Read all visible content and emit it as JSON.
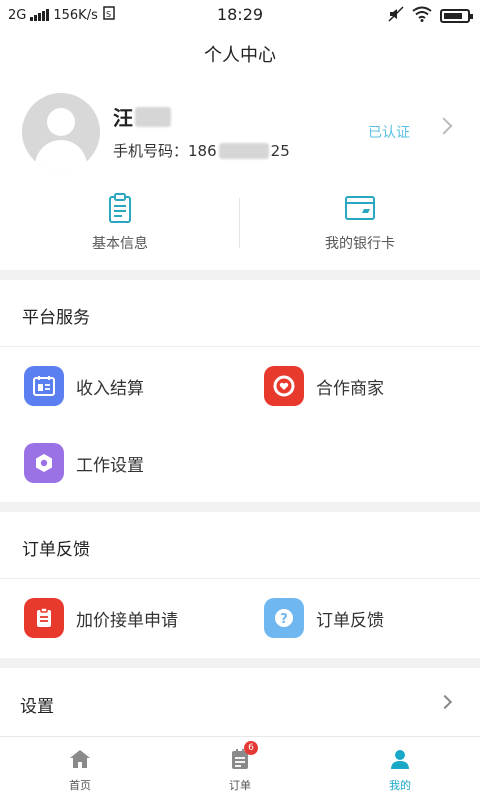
{
  "status_bar": {
    "network": "2G",
    "speed": "156K/s",
    "time": "18:29",
    "battery_level": 0.8
  },
  "header": {
    "title": "个人中心"
  },
  "profile": {
    "name_visible": "汪",
    "phone_label": "手机号码：",
    "phone_prefix": "186",
    "phone_suffix": "25",
    "verified_label": "已认证",
    "icons": {
      "avatar": "avatar-placeholder-icon",
      "chevron": "chevron-right-icon"
    }
  },
  "quick_actions": [
    {
      "label": "基本信息",
      "icon": "clipboard-icon"
    },
    {
      "label": "我的银行卡",
      "icon": "bank-card-icon"
    }
  ],
  "platform_services": {
    "title": "平台服务",
    "items": [
      {
        "label": "收入结算",
        "icon": "settlement-icon",
        "color": "#5b7ff0"
      },
      {
        "label": "合作商家",
        "icon": "partner-icon",
        "color": "#e8392d"
      },
      {
        "label": "工作设置",
        "icon": "work-settings-icon",
        "color": "#9b72e6"
      }
    ]
  },
  "order_feedback": {
    "title": "订单反馈",
    "items": [
      {
        "label": "加价接单申请",
        "icon": "markup-request-icon",
        "color": "#e8392d"
      },
      {
        "label": "订单反馈",
        "icon": "question-icon",
        "color": "#6fb7f0"
      }
    ]
  },
  "settings": {
    "label": "设置"
  },
  "tabbar": {
    "items": [
      {
        "label": "首页",
        "icon": "home-icon",
        "active": false
      },
      {
        "label": "订单",
        "icon": "order-icon",
        "active": false,
        "badge": "6"
      },
      {
        "label": "我的",
        "icon": "profile-icon",
        "active": true
      }
    ]
  },
  "colors": {
    "accent": "#1aa8c8",
    "verified": "#5bc0e0",
    "icon_teal": "#2aa6c0"
  }
}
